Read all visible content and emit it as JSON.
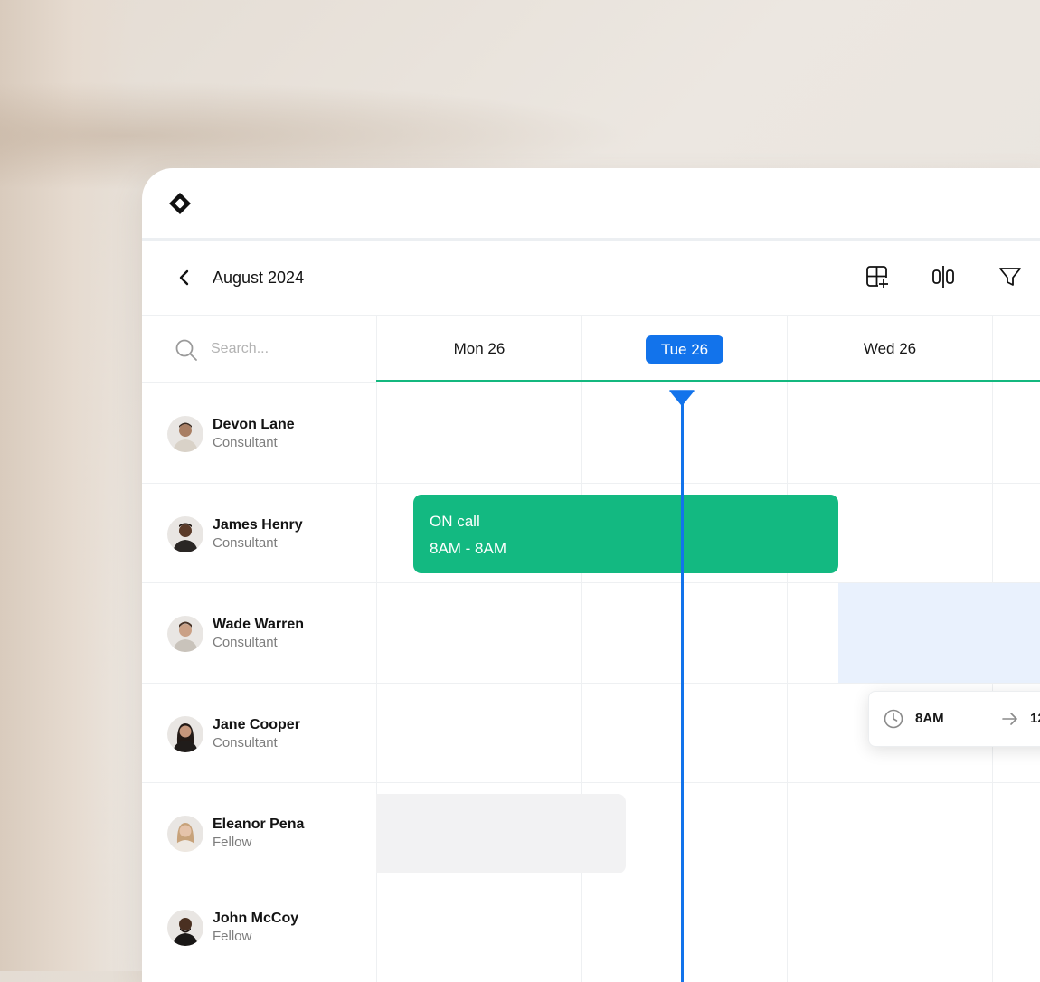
{
  "calendar": {
    "month_label": "August 2024",
    "search_placeholder": "Search...",
    "days": [
      {
        "label": "Mon 26",
        "is_today": false
      },
      {
        "label": "Tue 26",
        "is_today": true
      },
      {
        "label": "Wed 26",
        "is_today": false
      }
    ]
  },
  "people": [
    {
      "name": "Devon Lane",
      "role": "Consultant"
    },
    {
      "name": "James Henry",
      "role": "Consultant"
    },
    {
      "name": "Wade Warren",
      "role": "Consultant"
    },
    {
      "name": "Jane Cooper",
      "role": "Consultant"
    },
    {
      "name": "Eleanor Pena",
      "role": "Fellow"
    },
    {
      "name": "John McCoy",
      "role": "Fellow"
    }
  ],
  "event": {
    "title": "ON call",
    "time": "8AM - 8AM"
  },
  "time_popover": {
    "start": "8AM",
    "end": "12"
  },
  "colors": {
    "accent_blue": "#1273eb",
    "event_green": "#13b981",
    "highlight_blue": "#e9f1fd",
    "block_grey": "#f2f2f3"
  },
  "icons": {
    "logo": "diamond-logo-icon",
    "back": "chevron-left-icon",
    "add_view": "grid-add-icon",
    "split": "columns-split-icon",
    "filter": "filter-icon",
    "search": "search-icon",
    "clock": "clock-icon",
    "arrow": "arrow-right-icon"
  }
}
